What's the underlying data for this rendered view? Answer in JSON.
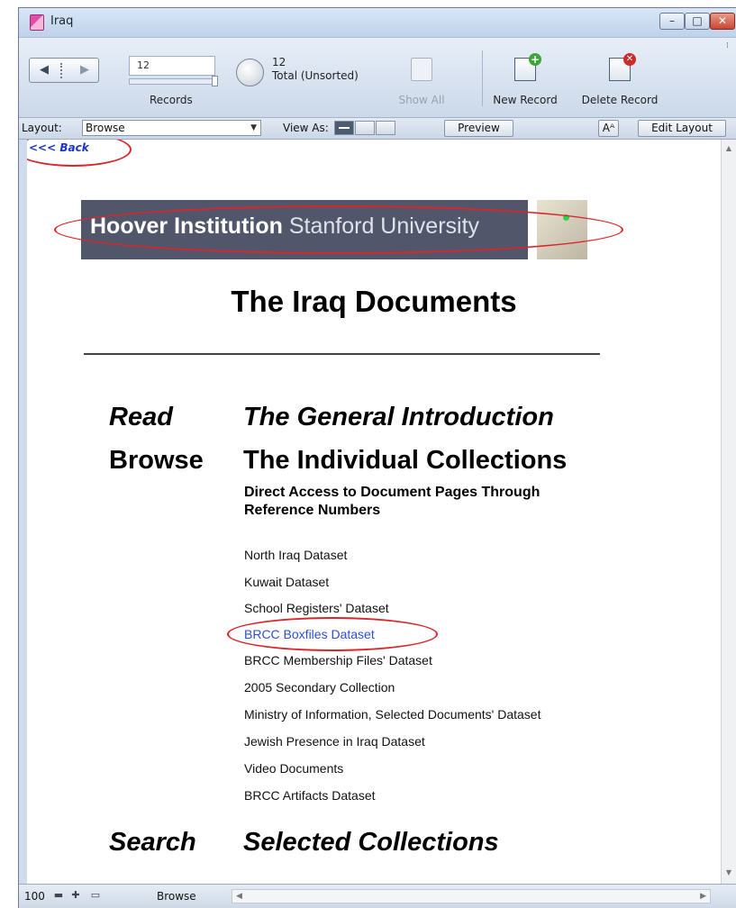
{
  "window": {
    "title": "Iraq",
    "min_glyph": "–",
    "max_glyph": "□",
    "close_glyph": "✕"
  },
  "toolbar": {
    "record_input": "12",
    "records_label": "Records",
    "total_count": "12",
    "total_label": "Total (Unsorted)",
    "show_all": "Show All",
    "new_record": "New Record",
    "delete_record": "Delete Record"
  },
  "layoutbar": {
    "layout_label": "Layout:",
    "layout_value": "Browse",
    "view_as_label": "View As:",
    "preview": "Preview",
    "aa": "Aᴬ",
    "edit_layout": "Edit Layout"
  },
  "content": {
    "back_link": "<<< Back",
    "banner_bold": "Hoover Institution",
    "banner_light": "Stanford University",
    "heading": "The Iraq Documents",
    "read_label": "Read",
    "read_title": "The General Introduction",
    "browse_label": "Browse",
    "browse_title": "The Individual Collections",
    "browse_sub_line1": "Direct Access to Document Pages Through",
    "browse_sub_line2": "Reference Numbers",
    "datasets": [
      "North Iraq Dataset",
      "Kuwait Dataset",
      "School Registers' Dataset",
      "BRCC Boxfiles Dataset",
      "BRCC Membership Files' Dataset",
      "2005 Secondary Collection",
      "Ministry of Information, Selected Documents' Dataset",
      "Jewish Presence in Iraq Dataset",
      "Video Documents",
      "BRCC Artifacts Dataset"
    ],
    "search_label": "Search",
    "search_title": "Selected Collections"
  },
  "statusbar": {
    "zoom": "100",
    "mode": "Browse"
  },
  "colors": {
    "annotation": "#d8262b",
    "link": "#2c4fd4",
    "back_link": "#1b34c8",
    "banner": "#51566b"
  }
}
